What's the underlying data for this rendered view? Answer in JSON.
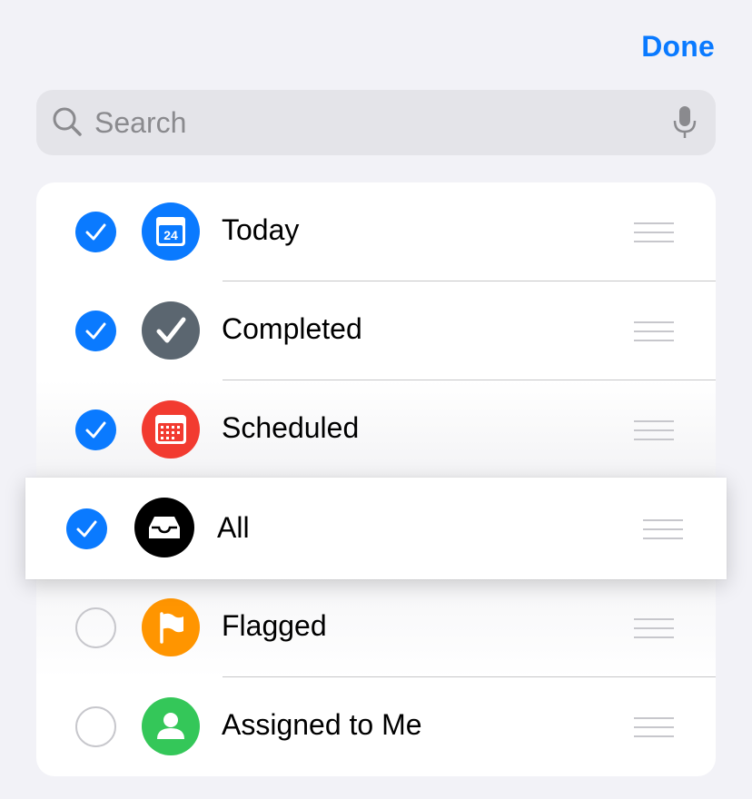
{
  "header": {
    "done_label": "Done"
  },
  "search": {
    "placeholder": "Search"
  },
  "lists": [
    {
      "label": "Today",
      "checked": true,
      "icon": "calendar-today-icon",
      "icon_color": "#0a7aff",
      "day": "24"
    },
    {
      "label": "Completed",
      "checked": true,
      "icon": "checkmark-icon",
      "icon_color": "#5b6670"
    },
    {
      "label": "Scheduled",
      "checked": true,
      "icon": "calendar-grid-icon",
      "icon_color": "#f23b30"
    },
    {
      "label": "All",
      "checked": true,
      "icon": "tray-icon",
      "icon_color": "#000000",
      "lifted": true
    },
    {
      "label": "Flagged",
      "checked": false,
      "icon": "flag-icon",
      "icon_color": "#ff9500"
    },
    {
      "label": "Assigned to Me",
      "checked": false,
      "icon": "person-icon",
      "icon_color": "#34c759"
    }
  ],
  "colors": {
    "accent": "#0a7aff",
    "background": "#f2f2f7",
    "row_bg": "#ffffff"
  }
}
